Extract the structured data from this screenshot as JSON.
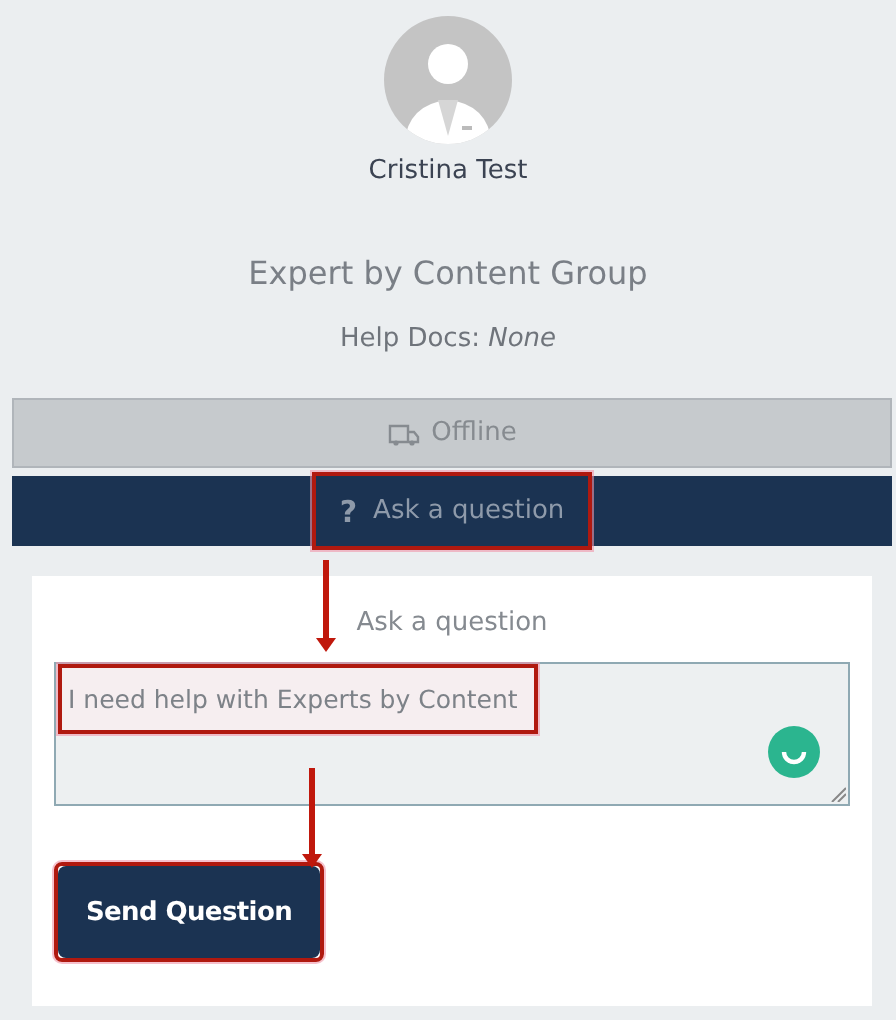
{
  "profile": {
    "name": "Cristina Test",
    "group": "Expert by Content Group",
    "help_docs_label": "Help Docs:",
    "help_docs_value": "None"
  },
  "status": {
    "label": "Offline",
    "online": false
  },
  "ask_tab": {
    "icon": "?",
    "label": "Ask a question"
  },
  "form": {
    "label": "Ask a question",
    "value": "I need help with Experts by Content",
    "button": "Send Question"
  },
  "annotations": [
    {
      "kind": "box"
    },
    {
      "kind": "arrow"
    },
    {
      "kind": "box"
    },
    {
      "kind": "arrow"
    },
    {
      "kind": "box"
    }
  ]
}
